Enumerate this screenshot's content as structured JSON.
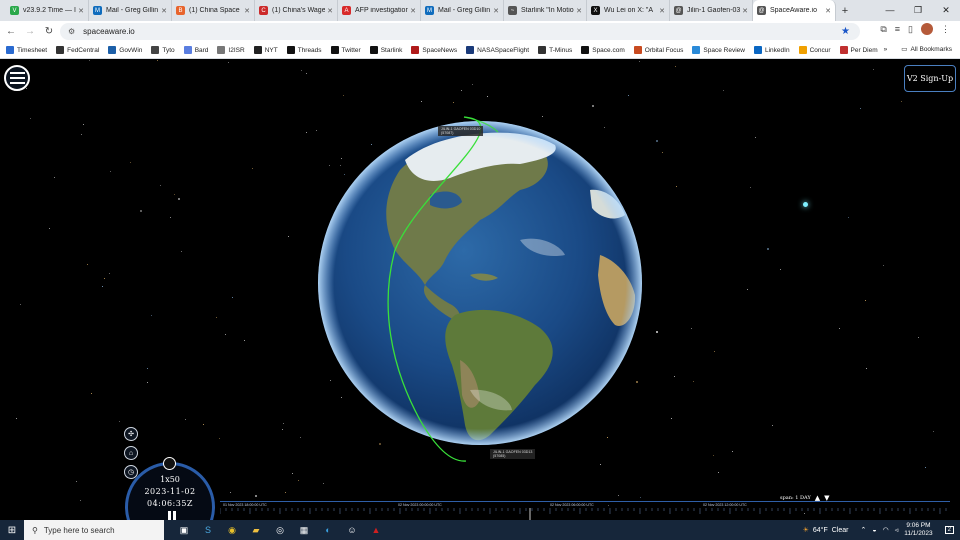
{
  "browser": {
    "tabs": [
      {
        "label": "v23.9.2 Time — I",
        "color": "#2aa84a",
        "glyph": "V"
      },
      {
        "label": "Mail - Greg Gillin",
        "color": "#0f6cbd",
        "glyph": "M"
      },
      {
        "label": "(1) China Space N",
        "color": "#e8642c",
        "glyph": "B"
      },
      {
        "label": "(1) China's Wage",
        "color": "#cc2a2a",
        "glyph": "C"
      },
      {
        "label": "AFP investigation",
        "color": "#d82a2a",
        "glyph": "A"
      },
      {
        "label": "Mail - Greg Gillin",
        "color": "#0f6cbd",
        "glyph": "M"
      },
      {
        "label": "Starlink \"In Motio",
        "color": "#555555",
        "glyph": "~"
      },
      {
        "label": "Wu Lei on X: \"A",
        "color": "#111111",
        "glyph": "X"
      },
      {
        "label": "Jilin-1 Gaofen-03",
        "color": "#555555",
        "glyph": "@"
      },
      {
        "label": "SpaceAware.io",
        "color": "#555555",
        "glyph": "@"
      }
    ],
    "active_tab": 9,
    "url": "spaceaware.io"
  },
  "bookmarks": [
    {
      "label": "Timesheet",
      "color": "#2a6ad0"
    },
    {
      "label": "FedCentral",
      "color": "#333333"
    },
    {
      "label": "GovWin",
      "color": "#1c5fa8"
    },
    {
      "label": "Tyto",
      "color": "#444444"
    },
    {
      "label": "Bard",
      "color": "#5a7ee0"
    },
    {
      "label": "I2ISR",
      "color": "#777777"
    },
    {
      "label": "NYT",
      "color": "#222222"
    },
    {
      "label": "Threads",
      "color": "#111111"
    },
    {
      "label": "Twitter",
      "color": "#111111"
    },
    {
      "label": "Starlink",
      "color": "#111111"
    },
    {
      "label": "SpaceNews",
      "color": "#b01a1a"
    },
    {
      "label": "NASASpaceFlight",
      "color": "#1a3a7a"
    },
    {
      "label": "T-Minus",
      "color": "#333333"
    },
    {
      "label": "Space.com",
      "color": "#111111"
    },
    {
      "label": "Orbital Focus",
      "color": "#c84a20"
    },
    {
      "label": "Space Review",
      "color": "#2a8ad8"
    },
    {
      "label": "LinkedIn",
      "color": "#0a66c2"
    },
    {
      "label": "Concur",
      "color": "#f0a000"
    },
    {
      "label": "Per Diem",
      "color": "#c03030"
    }
  ],
  "bookmarks_overflow": "»",
  "all_bookmarks": "All Bookmarks",
  "app": {
    "signup_label": "V2 Sign-Up",
    "satellite_label_top": "JILIN-1 GAOFEN 03D10",
    "satellite_label_top_id": "(57087)",
    "satellite_label_bottom": "JILIN-1 GAOFEN 03D13",
    "satellite_label_bottom_id": "(57085)",
    "orbit_color": "#39e03a",
    "clock": {
      "speed": "1x50",
      "date": "2023-11-02",
      "time": "04:06:35Z"
    },
    "timeline_labels": [
      "01 Nov 2023 18:00:00 UTC",
      "02 Nov 2023 00:00:00 UTC",
      "02 Nov 2023 06:00:00 UTC",
      "02 Nov 2023 12:00:00 UTC"
    ],
    "span_label": "span:",
    "span_value": "1 DAY"
  },
  "taskbar": {
    "search_placeholder": "Type here to search",
    "weather_temp": "64°F",
    "weather_text": "Clear",
    "time": "9:06 PM",
    "date": "11/1/2023",
    "notification_count": "2"
  }
}
